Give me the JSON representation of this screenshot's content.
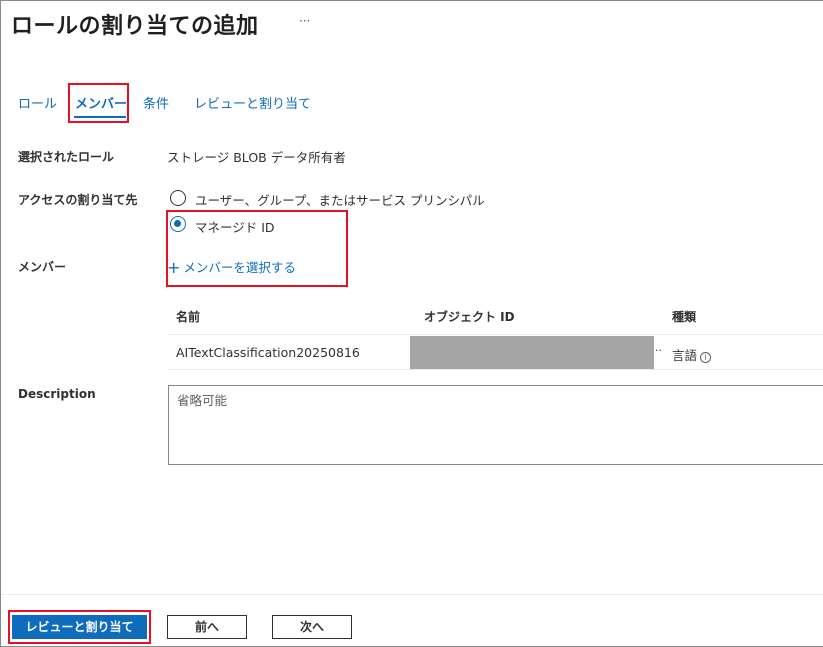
{
  "page": {
    "title": "ロールの割り当ての追加",
    "more_label": "···"
  },
  "tabs": [
    {
      "label": "ロール",
      "active": false
    },
    {
      "label": "メンバー",
      "active": true
    },
    {
      "label": "条件",
      "active": false
    },
    {
      "label": "レビューと割り当て",
      "active": false
    }
  ],
  "form": {
    "selected_role_label": "選択されたロール",
    "selected_role_value": "ストレージ BLOB データ所有者",
    "assign_access_label": "アクセスの割り当て先",
    "option_user": "ユーザー、グループ、またはサービス プリンシパル",
    "option_managed": "マネージド ID",
    "selected_option": "option_managed",
    "members_label": "メンバー",
    "select_members_link": "メンバーを選択する",
    "description_label": "Description",
    "description_placeholder": "省略可能"
  },
  "table": {
    "headers": [
      "名前",
      "オブジェクト ID",
      "種類"
    ],
    "rows": [
      {
        "name": "AITextClassification20250816",
        "object_id_overflow": "··",
        "type": "言語"
      }
    ]
  },
  "footer": {
    "review_button": "レビューと割り当て",
    "prev_button": "前へ",
    "next_button": "次へ"
  },
  "colors": {
    "accent": "#0f6cbd",
    "highlight": "#e81123",
    "redacted": "#a6a6a6"
  }
}
